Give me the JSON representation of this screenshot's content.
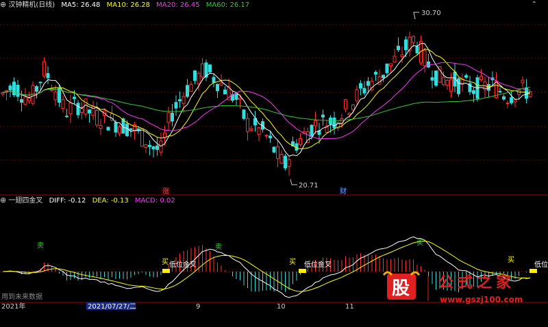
{
  "top_panel": {
    "name": "汉钟精机(日线)",
    "legend": [
      {
        "text": "MA5: 26.48",
        "color": "#ffffff"
      },
      {
        "text": "MA10: 26.28",
        "color": "#ffff00"
      },
      {
        "text": "MA20: 26.45",
        "color": "#ff33ff"
      },
      {
        "text": "MA60: 26.17",
        "color": "#33cc33"
      }
    ],
    "high_label": "30.70",
    "low_label": "20.71",
    "badge_zhang": "涨",
    "badge_cai": "财"
  },
  "bottom_panel": {
    "name": "一翅四金叉",
    "legend": [
      {
        "text": "DIFF: -0.12",
        "color": "#ffffff"
      },
      {
        "text": "DEA: -0.13",
        "color": "#ffff00"
      },
      {
        "text": "MACD: 0.02",
        "color": "#ff33ff"
      }
    ],
    "signals": {
      "sell": "卖",
      "buy": "买",
      "low_cross": "低位金叉",
      "low_cross_short": "低位"
    },
    "future_data": "用到未来数据"
  },
  "time_axis": {
    "year": "2021年",
    "cursor_date": "2021/07/27/二",
    "months": [
      "9",
      "10",
      "11"
    ]
  },
  "watermark": {
    "logo_char": "股",
    "text": "公式之家",
    "url": "www.gszj100.com"
  },
  "colors": {
    "up": "#ff3333",
    "down": "#33dddd",
    "grid": "#7a0000",
    "ma5": "#ffffff",
    "ma10": "#ffff00",
    "ma20": "#ff33ff",
    "ma60": "#33cc33",
    "signal_yellow": "#ffff00",
    "brand_red": "#e02020"
  },
  "chart_data": [
    {
      "type": "candlestick",
      "title": "汉钟精机(日线)",
      "price_range": [
        20.0,
        31.5
      ],
      "high": 30.7,
      "low": 20.71,
      "moving_averages": {
        "MA5": 26.48,
        "MA10": 26.28,
        "MA20": 26.45,
        "MA60": 26.17
      },
      "grid": true
    },
    {
      "type": "macd",
      "title": "一翅四金叉",
      "values": {
        "DIFF": -0.12,
        "DEA": -0.13,
        "MACD": 0.02
      },
      "grid": true
    }
  ]
}
